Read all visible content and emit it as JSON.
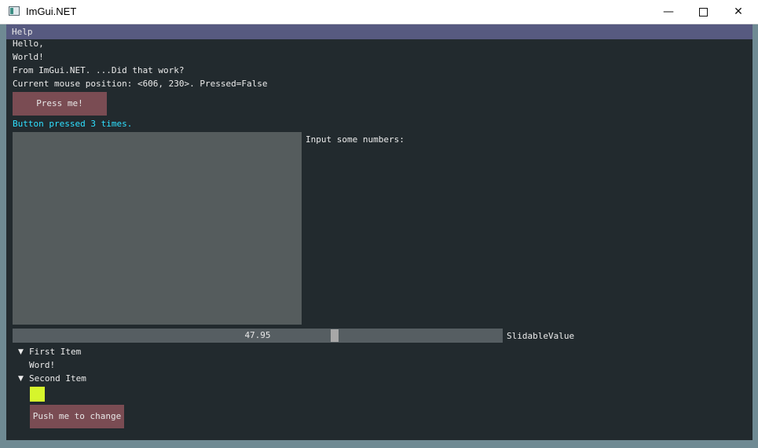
{
  "window": {
    "title": "ImGui.NET",
    "minimize_glyph": "—",
    "close_glyph": "✕"
  },
  "menubar": {
    "items": [
      {
        "label": "Help"
      }
    ]
  },
  "main": {
    "line1": "Hello,",
    "line2": "World!",
    "line3": "From ImGui.NET. ...Did that work?",
    "mouse_text": "Current mouse position: <606, 230>. Pressed=False",
    "press_button_label": "Press me!",
    "press_status": "Button pressed 3 times.",
    "input_label": "Input some numbers:",
    "slider": {
      "value": "47.95",
      "label": "SlidableValue",
      "fraction": 0.66
    },
    "tree": [
      {
        "label": "First Item",
        "expanded": true,
        "child_text": "Word!"
      },
      {
        "label": "Second Item",
        "expanded": true
      }
    ],
    "tree_arrow": "▼",
    "swatch_color": "#d6f52c",
    "push_button_label": "Push me to change"
  },
  "colors": {
    "window_bg": "#222a2e",
    "menubar_bg": "#575a80",
    "button_bg": "#7a4c53",
    "accent_text": "#2fe0ff"
  }
}
